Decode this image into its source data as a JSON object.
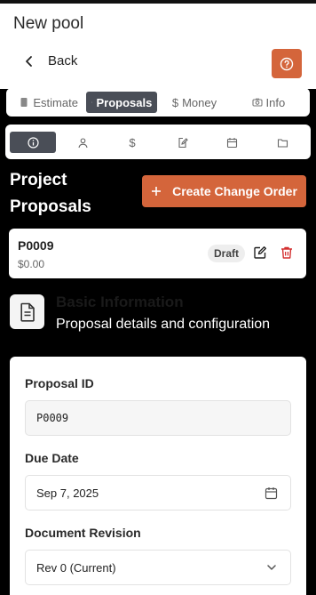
{
  "header": {
    "title": "New pool",
    "back_label": "Back"
  },
  "main_tabs": [
    {
      "label": "Estimate",
      "icon": "file-icon",
      "active": false
    },
    {
      "label": "Proposals",
      "icon": "document-icon",
      "active": true
    },
    {
      "label": "Money",
      "icon": "dollar-icon",
      "active": false
    },
    {
      "label": "Info",
      "icon": "camera-icon",
      "active": false
    }
  ],
  "sub_tabs": [
    {
      "icon": "info-icon",
      "active": true
    },
    {
      "icon": "user-icon",
      "active": false
    },
    {
      "icon": "dollar-icon",
      "active": false
    },
    {
      "icon": "edit-document-icon",
      "active": false
    },
    {
      "icon": "calendar-icon",
      "active": false
    },
    {
      "icon": "folder-icon",
      "active": false
    }
  ],
  "section": {
    "title": "Project Proposals",
    "create_button": "Create Change Order"
  },
  "proposal": {
    "id": "P0009",
    "amount": "$0.00",
    "status": "Draft"
  },
  "basic_info": {
    "heading": "Basic Information",
    "subtitle": "Proposal details and configuration"
  },
  "form": {
    "proposal_id_label": "Proposal ID",
    "proposal_id_value": "P0009",
    "due_date_label": "Due Date",
    "due_date_value": "Sep 7, 2025",
    "revision_label": "Document Revision",
    "revision_value": "Rev 0 (Current)"
  },
  "colors": {
    "accent": "#d4653b",
    "tab_active": "#4a4e57",
    "delete": "#d32f2f"
  }
}
